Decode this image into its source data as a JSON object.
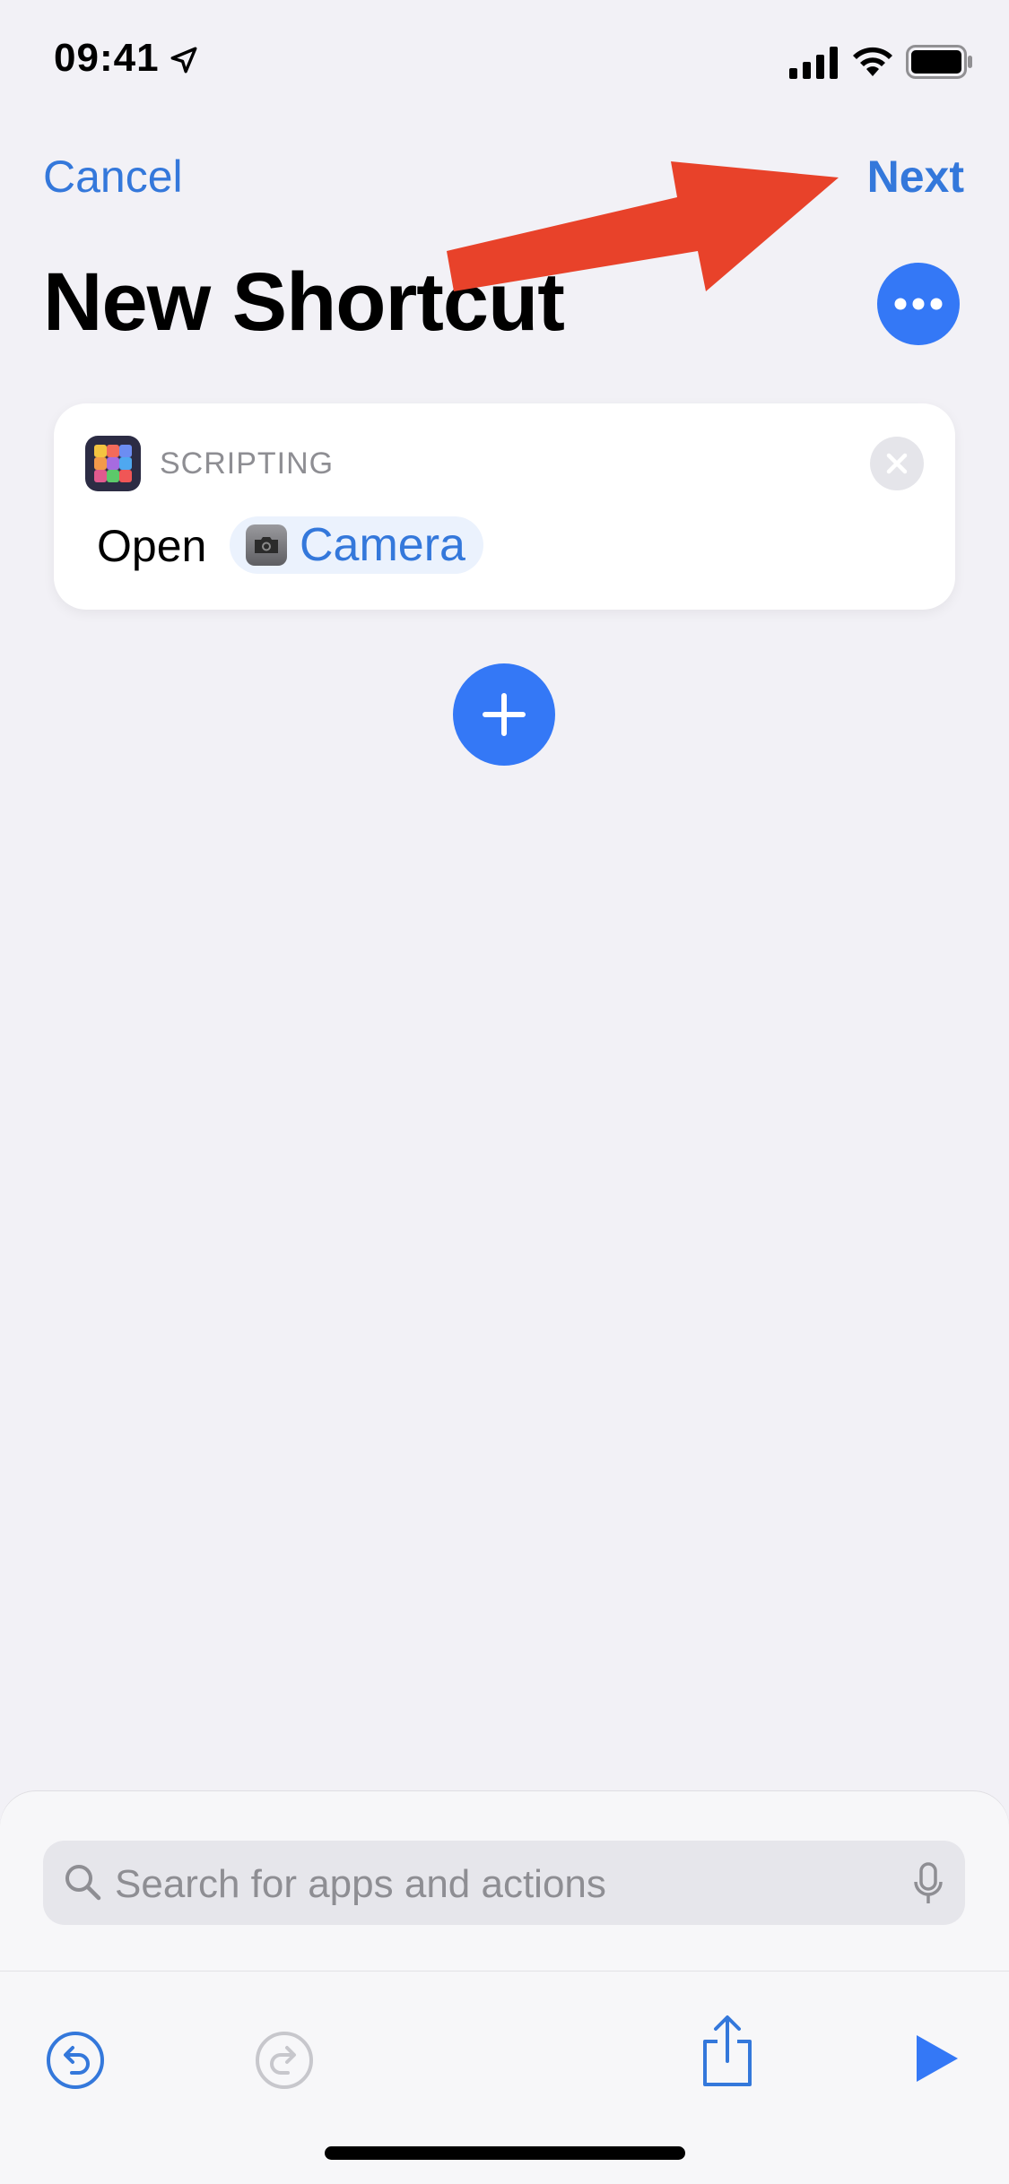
{
  "status_bar": {
    "time": "09:41",
    "icons": [
      "location-arrow-icon",
      "cellular-signal-icon",
      "wifi-icon",
      "battery-icon"
    ]
  },
  "nav": {
    "cancel_label": "Cancel",
    "next_label": "Next",
    "title": "New Shortcut",
    "more_icon": "ellipsis-icon"
  },
  "action_card": {
    "category": "SCRIPTING",
    "verb": "Open",
    "app_name": "Camera",
    "app_icon": "camera-icon",
    "remove_icon": "close-icon"
  },
  "add_action_icon": "plus-icon",
  "search": {
    "placeholder": "Search for apps and actions",
    "icons": [
      "search-icon",
      "microphone-icon"
    ]
  },
  "toolbar": {
    "items": [
      "undo-icon",
      "redo-icon",
      "share-icon",
      "play-icon"
    ]
  },
  "colors": {
    "accent": "#3478F6",
    "link": "#3478DB",
    "background": "#F2F1F6",
    "annotation_arrow": "#E8422A"
  }
}
